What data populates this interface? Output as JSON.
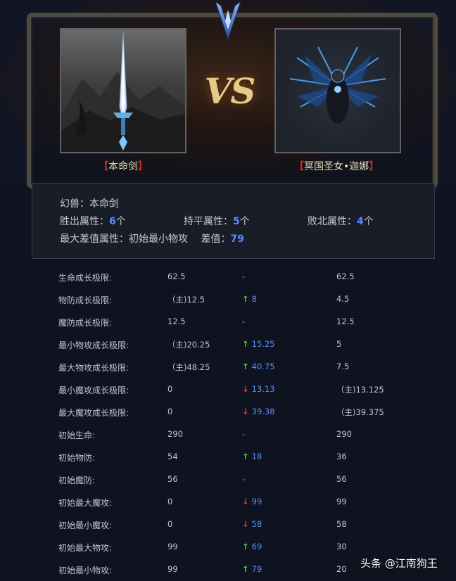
{
  "header": {
    "vs_text": "VS",
    "bracket_open": "【",
    "bracket_close": "】",
    "left_name": "本命剑",
    "right_name": "冥国圣女•迦娜"
  },
  "summary": {
    "pet_label": "幻兽：",
    "pet_name": "本命剑",
    "win_label": "胜出属性：",
    "win_count": "6",
    "draw_label": "持平属性：",
    "draw_count": "5",
    "lose_label": "败北属性：",
    "lose_count": "4",
    "unit": "个",
    "max_diff_label": "最大差值属性：",
    "max_diff_attr": "初始最小物攻",
    "diff_label": "差值：",
    "diff_value": "79"
  },
  "stats": [
    {
      "label": "生命成长极限:",
      "left": "62.5",
      "dir": "none",
      "diff": "-",
      "right": "62.5"
    },
    {
      "label": "物防成长极限:",
      "left": "（主)12.5",
      "dir": "up",
      "diff": "8",
      "right": "4.5"
    },
    {
      "label": "魔防成长极限:",
      "left": "12.5",
      "dir": "none",
      "diff": "-",
      "right": "12.5"
    },
    {
      "label": "最小物攻成长极限:",
      "left": "（主)20.25",
      "dir": "up",
      "diff": "15.25",
      "right": "5"
    },
    {
      "label": "最大物攻成长极限:",
      "left": "（主)48.25",
      "dir": "up",
      "diff": "40.75",
      "right": "7.5"
    },
    {
      "label": "最小魔攻成长极限:",
      "left": "0",
      "dir": "down",
      "diff": "13.13",
      "right": "（主)13.125"
    },
    {
      "label": "最大魔攻成长极限:",
      "left": "0",
      "dir": "down",
      "diff": "39.38",
      "right": "（主)39.375"
    },
    {
      "label": "初始生命:",
      "left": "290",
      "dir": "none",
      "diff": "-",
      "right": "290"
    },
    {
      "label": "初始物防:",
      "left": "54",
      "dir": "up",
      "diff": "18",
      "right": "36"
    },
    {
      "label": "初始魔防:",
      "left": "56",
      "dir": "none",
      "diff": "-",
      "right": "56"
    },
    {
      "label": "初始最大魔攻:",
      "left": "0",
      "dir": "down",
      "diff": "99",
      "right": "99"
    },
    {
      "label": "初始最小魔攻:",
      "left": "0",
      "dir": "down",
      "diff": "58",
      "right": "58"
    },
    {
      "label": "初始最大物攻:",
      "left": "99",
      "dir": "up",
      "diff": "69",
      "right": "30"
    },
    {
      "label": "初始最小物攻:",
      "left": "99",
      "dir": "up",
      "diff": "79",
      "right": "20"
    }
  ],
  "arrows": {
    "up": "↑",
    "down": "↓"
  },
  "watermark": "头条 @江南狗王",
  "icons": {
    "left_portrait": "sword-icon",
    "right_portrait": "dark-saint-character-icon",
    "crest": "winged-crest-icon"
  },
  "colors": {
    "win_up": "#3fcf6c",
    "lose_down": "#e23a3a",
    "count_blue": "#5a8cff",
    "bracket_red": "#d0281c",
    "vs_gold": "#e8c98a"
  }
}
